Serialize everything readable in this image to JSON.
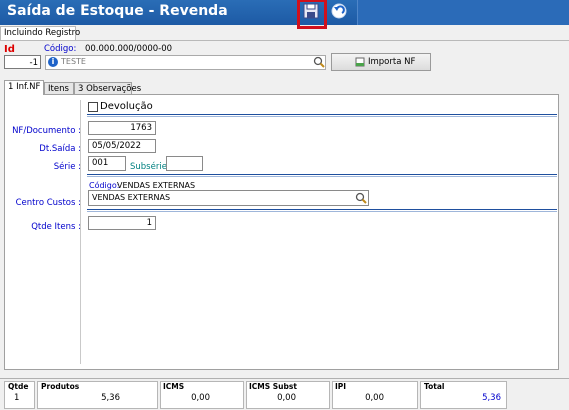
{
  "window": {
    "title": "Saída de Estoque - Revenda"
  },
  "status": {
    "mode": "Incluindo Registro"
  },
  "header": {
    "id_label": "Id",
    "id_value": "-1",
    "code_label": "Código:",
    "code_value": "00.000.000/0000-00",
    "customer_value": "TESTE",
    "import_label": "Importa NF"
  },
  "tabs": [
    {
      "label": "1 Inf.NF"
    },
    {
      "label": "Itens"
    },
    {
      "label": "3 Observações"
    }
  ],
  "form": {
    "devolucao_label": "Devolução",
    "nf_label": "NF/Documento :",
    "nf_value": "1763",
    "dtsaida_label": "Dt.Saída :",
    "dtsaida_value": "05/05/2022",
    "serie_label": "Série :",
    "serie_value": "001",
    "subserie_label": "Subsérie :",
    "subserie_value": "",
    "cc_code_label": "Código:",
    "cc_code_value": "VENDAS EXTERNAS",
    "cc_label": "Centro Custos :",
    "cc_value": "VENDAS EXTERNAS",
    "qtde_label": "Qtde Itens :",
    "qtde_value": "1"
  },
  "totals": {
    "qtde_label": "Qtde",
    "qtde_value": "1",
    "produtos_label": "Produtos",
    "produtos_value": "5,36",
    "icms_label": "ICMS",
    "icms_value": "0,00",
    "icms_subst_label": "ICMS Subst",
    "icms_subst_value": "0,00",
    "ipi_label": "IPI",
    "ipi_value": "0,00",
    "total_label": "Total",
    "total_value": "5,36"
  },
  "colors": {
    "titlebar": "#1d5aa5",
    "label_blue": "#0000cc",
    "id_red": "#dd0000",
    "highlight": "#d0101c"
  }
}
